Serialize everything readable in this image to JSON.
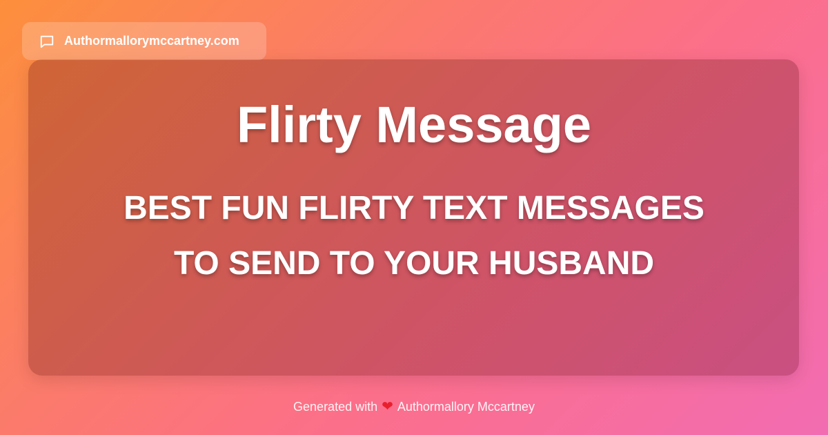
{
  "badge": {
    "icon": "chat-bubble-icon",
    "text": "Authormallorymccartney.com"
  },
  "card": {
    "title": "Flirty Message",
    "subtitle": "BEST FUN FLIRTY TEXT MESSAGES TO SEND TO YOUR HUSBAND"
  },
  "footer": {
    "prefix": "Generated with",
    "icon": "heart-icon",
    "author": "Authormallory Mccartney"
  },
  "colors": {
    "gradient_start": "#fd8f3c",
    "gradient_mid": "#fc6f8a",
    "gradient_end": "#f26cb2",
    "heart": "#e8202e"
  }
}
